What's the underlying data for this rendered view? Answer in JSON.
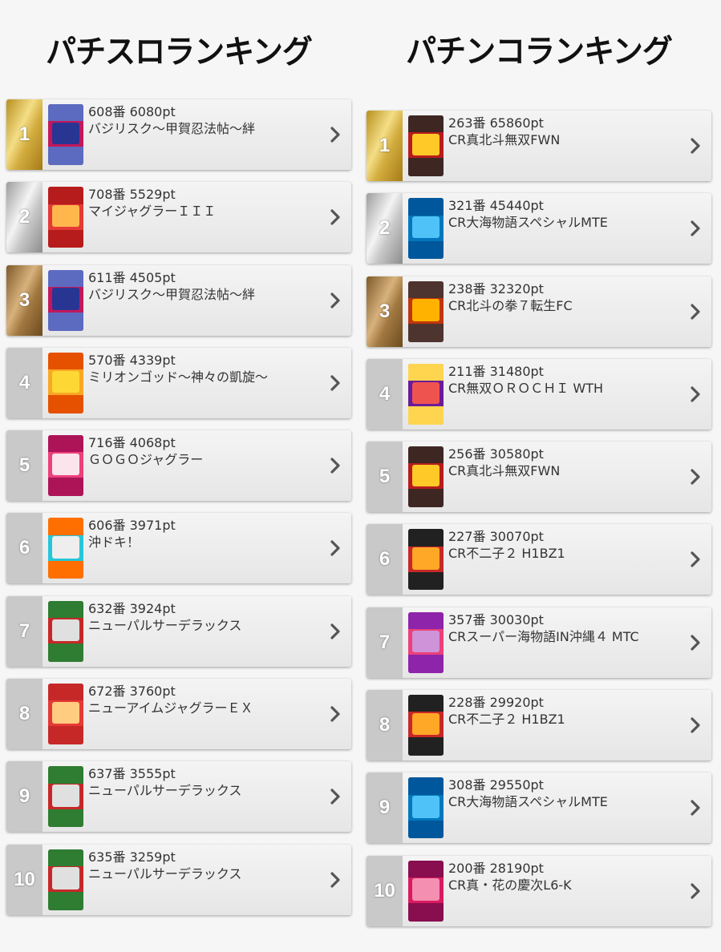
{
  "slot": {
    "title": "パチスロランキング",
    "items": [
      {
        "rank": "1",
        "pt": "608番 6080pt",
        "name": "バジリスク～甲賀忍法帖～絆",
        "medal": "gold",
        "colors": [
          "#c2185b",
          "#283593",
          "#5c6bc0"
        ]
      },
      {
        "rank": "2",
        "pt": "708番 5529pt",
        "name": "マイジャグラーＩＩＩ",
        "medal": "silver",
        "colors": [
          "#e53935",
          "#ffb74d",
          "#b71c1c"
        ]
      },
      {
        "rank": "3",
        "pt": "611番 4505pt",
        "name": "バジリスク～甲賀忍法帖～絆",
        "medal": "bronze",
        "colors": [
          "#c2185b",
          "#283593",
          "#5c6bc0"
        ]
      },
      {
        "rank": "4",
        "pt": "570番 4339pt",
        "name": "ミリオンゴッド～神々の凱旋～",
        "medal": "none",
        "colors": [
          "#f9a825",
          "#fdd835",
          "#e65100"
        ]
      },
      {
        "rank": "5",
        "pt": "716番 4068pt",
        "name": "ＧＯＧＯジャグラー",
        "medal": "none",
        "colors": [
          "#ec407a",
          "#fce4ec",
          "#ad1457"
        ]
      },
      {
        "rank": "6",
        "pt": "606番 3971pt",
        "name": "沖ドキ！",
        "medal": "none",
        "colors": [
          "#26c6da",
          "#eeeeee",
          "#ff6f00"
        ]
      },
      {
        "rank": "7",
        "pt": "632番 3924pt",
        "name": "ニューパルサーデラックス",
        "medal": "none",
        "colors": [
          "#c62828",
          "#e0e0e0",
          "#2e7d32"
        ]
      },
      {
        "rank": "8",
        "pt": "672番 3760pt",
        "name": "ニューアイムジャグラーＥＸ",
        "medal": "none",
        "colors": [
          "#e53935",
          "#ffcc80",
          "#c62828"
        ]
      },
      {
        "rank": "9",
        "pt": "637番 3555pt",
        "name": "ニューパルサーデラックス",
        "medal": "none",
        "colors": [
          "#c62828",
          "#e0e0e0",
          "#2e7d32"
        ]
      },
      {
        "rank": "10",
        "pt": "635番 3259pt",
        "name": "ニューパルサーデラックス",
        "medal": "none",
        "colors": [
          "#c62828",
          "#e0e0e0",
          "#2e7d32"
        ]
      }
    ]
  },
  "pachinko": {
    "title": "パチンコランキング",
    "items": [
      {
        "rank": "1",
        "pt": "263番 65860pt",
        "name": "CR真北斗無双FWN",
        "medal": "gold",
        "colors": [
          "#b71c1c",
          "#ffca28",
          "#3e2723"
        ]
      },
      {
        "rank": "2",
        "pt": "321番 45440pt",
        "name": "CR大海物語スペシャルMTE",
        "medal": "silver",
        "colors": [
          "#0277bd",
          "#4fc3f7",
          "#01579b"
        ]
      },
      {
        "rank": "3",
        "pt": "238番 32320pt",
        "name": "CR北斗の拳７転生FC",
        "medal": "bronze",
        "colors": [
          "#bf360c",
          "#ffb300",
          "#4e342e"
        ]
      },
      {
        "rank": "4",
        "pt": "211番 31480pt",
        "name": "CR無双ＯＲＯＣＨＩ WTH",
        "medal": "none",
        "colors": [
          "#6a1b9a",
          "#ef5350",
          "#ffd54f"
        ]
      },
      {
        "rank": "5",
        "pt": "256番 30580pt",
        "name": "CR真北斗無双FWN",
        "medal": "none",
        "colors": [
          "#b71c1c",
          "#ffca28",
          "#3e2723"
        ]
      },
      {
        "rank": "6",
        "pt": "227番 30070pt",
        "name": "CR不二子２ H1BZ1",
        "medal": "none",
        "colors": [
          "#c62828",
          "#ffa726",
          "#212121"
        ]
      },
      {
        "rank": "7",
        "pt": "357番 30030pt",
        "name": "CRスーパー海物語IN沖縄４ MTC",
        "medal": "none",
        "colors": [
          "#ec407a",
          "#ce93d8",
          "#8e24aa"
        ]
      },
      {
        "rank": "8",
        "pt": "228番 29920pt",
        "name": "CR不二子２ H1BZ1",
        "medal": "none",
        "colors": [
          "#c62828",
          "#ffa726",
          "#212121"
        ]
      },
      {
        "rank": "9",
        "pt": "308番 29550pt",
        "name": "CR大海物語スペシャルMTE",
        "medal": "none",
        "colors": [
          "#0277bd",
          "#4fc3f7",
          "#01579b"
        ]
      },
      {
        "rank": "10",
        "pt": "200番 28190pt",
        "name": "CR真・花の慶次L6-K",
        "medal": "none",
        "colors": [
          "#d81b60",
          "#f48fb1",
          "#880e4f"
        ]
      }
    ]
  },
  "icons": {
    "chevron": "chevron-right-icon"
  }
}
